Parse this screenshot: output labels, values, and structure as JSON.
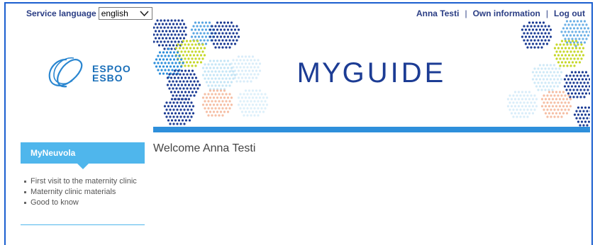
{
  "header": {
    "language_label": "Service language",
    "language_value": "english",
    "user_name": "Anna Testi",
    "separator": "|",
    "own_info_link": "Own information",
    "logout_link": "Log out"
  },
  "logo": {
    "line1": "ESPOO",
    "line2": "ESBO"
  },
  "banner": {
    "title_my": "MY",
    "title_guide": "GUIDE",
    "dot_colors": [
      "#1c3c94",
      "#2e8fdb",
      "#c6d82b",
      "#f4b79a",
      "#9fd3f0"
    ]
  },
  "sidebar": {
    "heading": "MyNeuvola",
    "items": [
      {
        "label": "First visit to the maternity clinic"
      },
      {
        "label": "Maternity clinic materials"
      },
      {
        "label": "Good to know"
      }
    ]
  },
  "main": {
    "welcome": "Welcome Anna Testi"
  }
}
